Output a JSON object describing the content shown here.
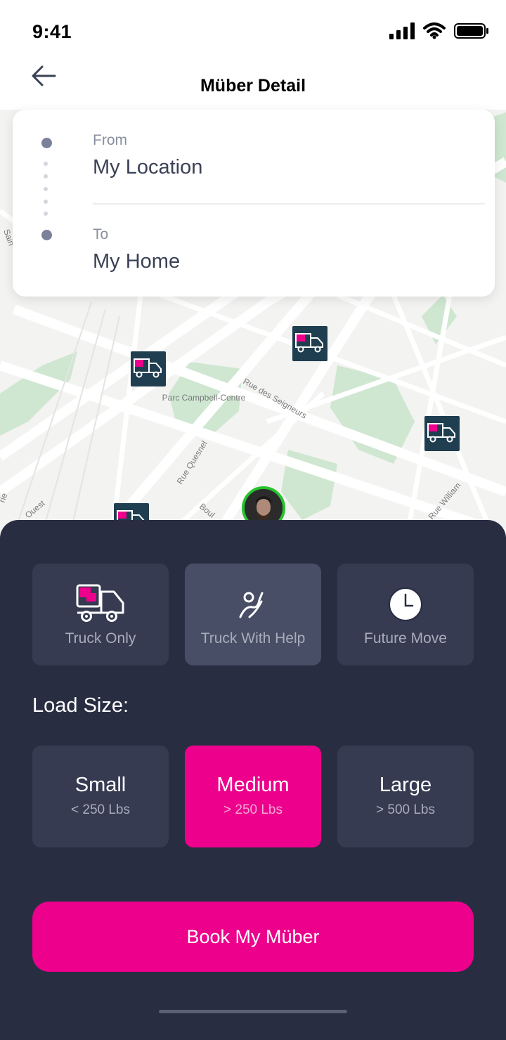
{
  "status_bar": {
    "time": "9:41"
  },
  "header": {
    "title": "Müber Detail"
  },
  "route": {
    "from_label": "From",
    "from_value": "My Location",
    "to_label": "To",
    "to_value": "My Home"
  },
  "map_labels": {
    "park": "Parc Campbell-Centre",
    "street_seigneurs": "Rue des Seigneurs",
    "street_quesnel": "Rue Quesnel",
    "street_william": "Rue William",
    "street_ouest": "Ouest",
    "street_boul": "Boul",
    "street_saint": "Sain",
    "street_rie": "rie"
  },
  "service_options": [
    {
      "label": "Truck Only",
      "icon": "truck-icon"
    },
    {
      "label": "Truck With Help",
      "icon": "helper-icon"
    },
    {
      "label": "Future Move",
      "icon": "clock-icon"
    }
  ],
  "load": {
    "title": "Load Size:",
    "sizes": [
      {
        "name": "Small",
        "sub": "< 250 Lbs"
      },
      {
        "name": "Medium",
        "sub": "> 250 Lbs"
      },
      {
        "name": "Large",
        "sub": "> 500 Lbs"
      }
    ]
  },
  "book_button": "Book My Müber",
  "colors": {
    "accent": "#ec008c",
    "sheet": "#282d42",
    "card": "#363b52",
    "marker": "#1f3e50",
    "park": "#cfe7d1"
  }
}
